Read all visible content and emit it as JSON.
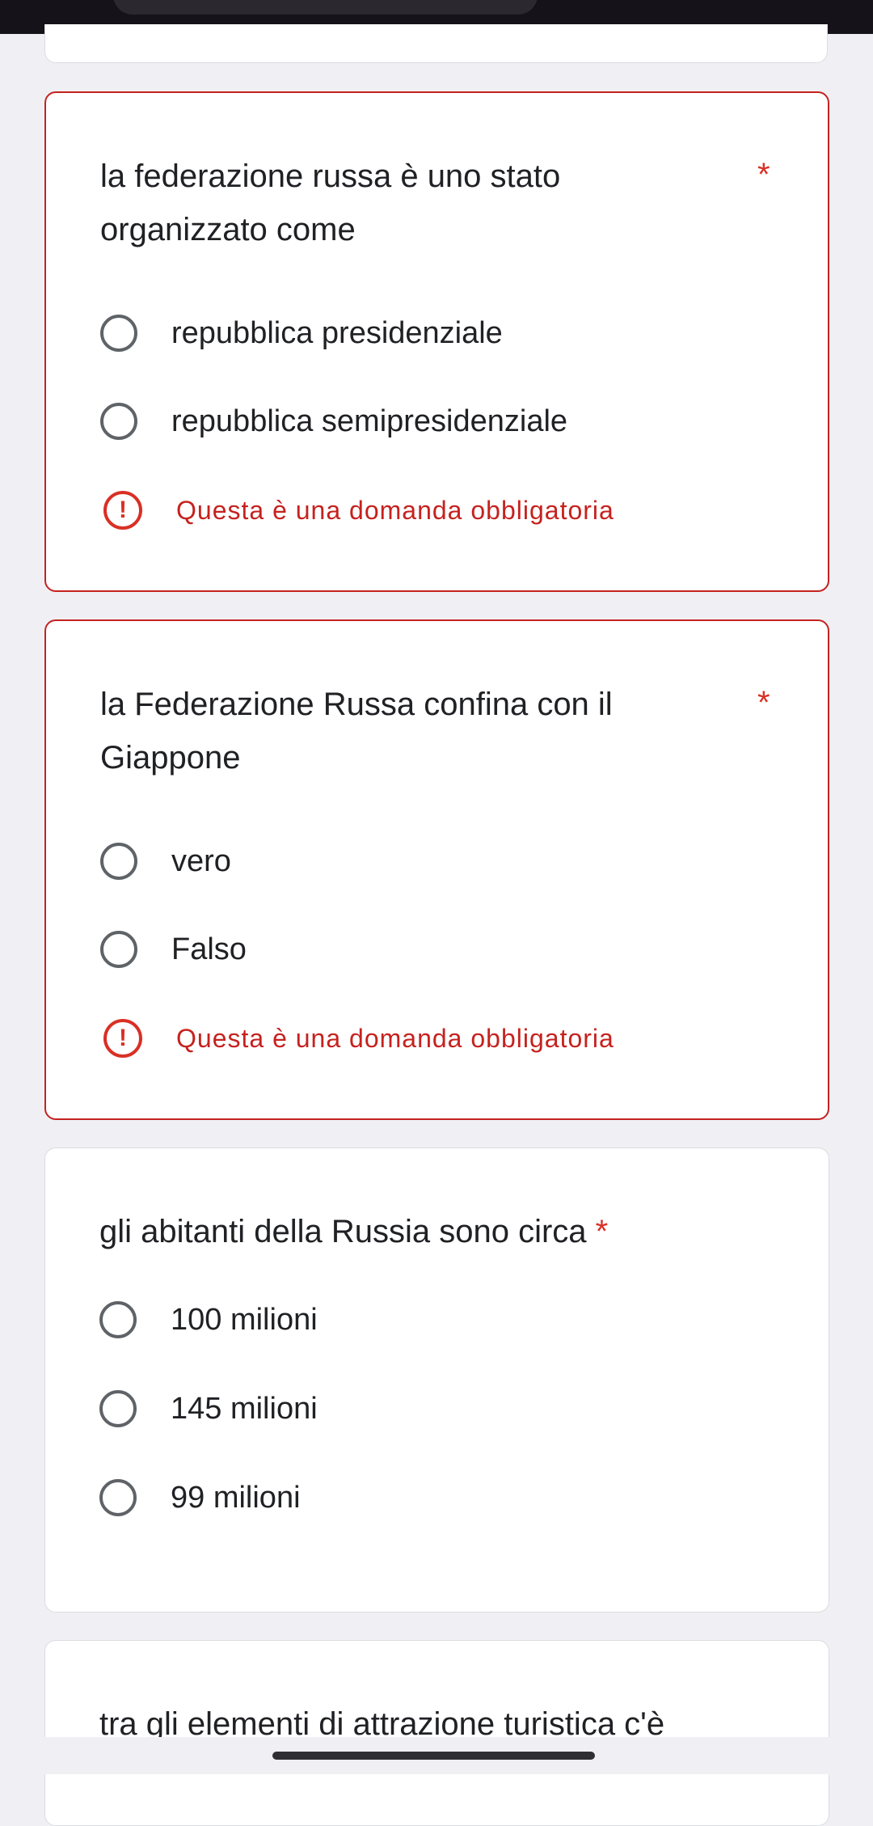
{
  "questions": [
    {
      "title": "la federazione russa è uno stato organizzato come",
      "required_mark": "*",
      "options": [
        "repubblica presidenziale",
        "repubblica semipresidenziale"
      ],
      "error": "Questa è una domanda obbligatoria"
    },
    {
      "title": "la Federazione Russa confina con il Giappone",
      "required_mark": "*",
      "options": [
        "vero",
        "Falso"
      ],
      "error": "Questa è una domanda obbligatoria"
    },
    {
      "title": "gli abitanti della Russia sono circa",
      "required_mark": "*",
      "options": [
        "100 milioni",
        "145 milioni",
        "99 milioni"
      ]
    },
    {
      "title": "tra gli elementi di attrazione turistica c'è"
    }
  ],
  "icons": {
    "error_icon_glyph": "!"
  },
  "colors": {
    "error": "#d93025",
    "background": "#f0f0f4",
    "card": "#ffffff"
  }
}
